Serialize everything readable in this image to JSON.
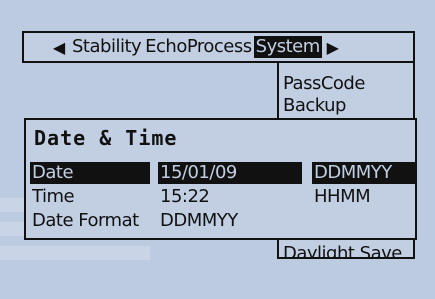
{
  "tabs": {
    "left_arrow": "◀",
    "right_arrow": "▶",
    "items": [
      "Stability",
      "EchoProcess",
      "System"
    ],
    "selected": "System"
  },
  "system_menu": {
    "items": [
      "PassCode",
      "Backup",
      "Daylight Save"
    ]
  },
  "dialog": {
    "title": "Date & Time",
    "rows": [
      {
        "label": "Date",
        "value": "15/01/09",
        "format": "DDMMYY"
      },
      {
        "label": "Time",
        "value": "15:22",
        "format": "HHMM"
      },
      {
        "label": "Date Format",
        "value": "DDMMYY",
        "format": ""
      }
    ]
  }
}
